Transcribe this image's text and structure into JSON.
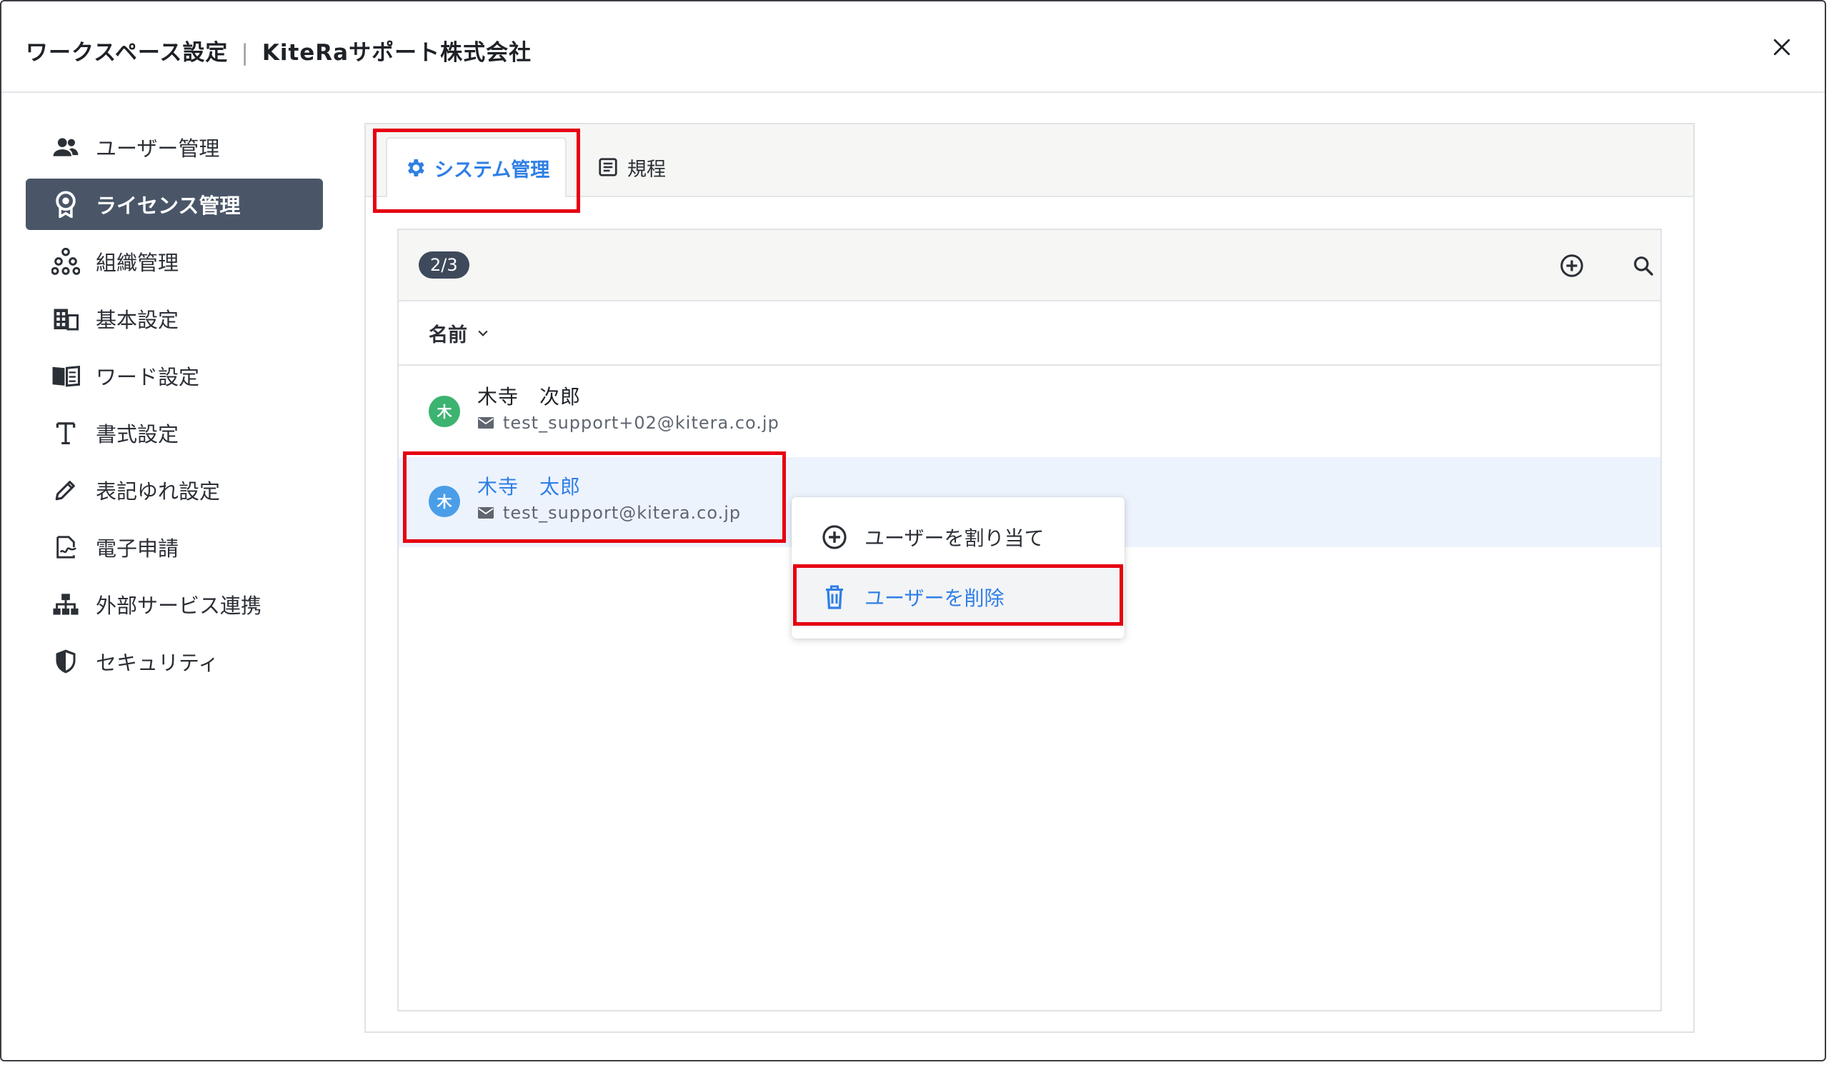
{
  "header": {
    "title": "ワークスペース設定",
    "separator": "|",
    "org_name": "KiteRaサポート株式会社"
  },
  "sidebar": {
    "items": [
      {
        "label": "ユーザー管理",
        "icon": "users-icon"
      },
      {
        "label": "ライセンス管理",
        "icon": "license-badge-icon",
        "active": true
      },
      {
        "label": "組織管理",
        "icon": "org-tree-icon"
      },
      {
        "label": "基本設定",
        "icon": "building-icon"
      },
      {
        "label": "ワード設定",
        "icon": "book-icon"
      },
      {
        "label": "書式設定",
        "icon": "text-format-icon"
      },
      {
        "label": "表記ゆれ設定",
        "icon": "pencil-icon"
      },
      {
        "label": "電子申請",
        "icon": "document-signature-icon"
      },
      {
        "label": "外部サービス連携",
        "icon": "sitemap-icon"
      },
      {
        "label": "セキュリティ",
        "icon": "shield-icon"
      }
    ]
  },
  "tabs": [
    {
      "label": "システム管理",
      "icon": "gear-icon",
      "active": true
    },
    {
      "label": "規程",
      "icon": "document-list-icon"
    }
  ],
  "list": {
    "count": "2/3",
    "sort_label": "名前",
    "users": [
      {
        "avatar": "木",
        "avatar_color": "#3cb371",
        "name": "木寺　次郎",
        "email": "test_support+02@kitera.co.jp"
      },
      {
        "avatar": "木",
        "avatar_color": "#4a9ee8",
        "name": "木寺　太郎",
        "email": "test_support@kitera.co.jp",
        "selected": true
      }
    ]
  },
  "context_menu": {
    "assign_label": "ユーザーを割り当て",
    "delete_label": "ユーザーを削除"
  },
  "colors": {
    "accent": "#2f7fe6",
    "sidebar_active": "#4a5668",
    "highlight": "#e60012"
  }
}
